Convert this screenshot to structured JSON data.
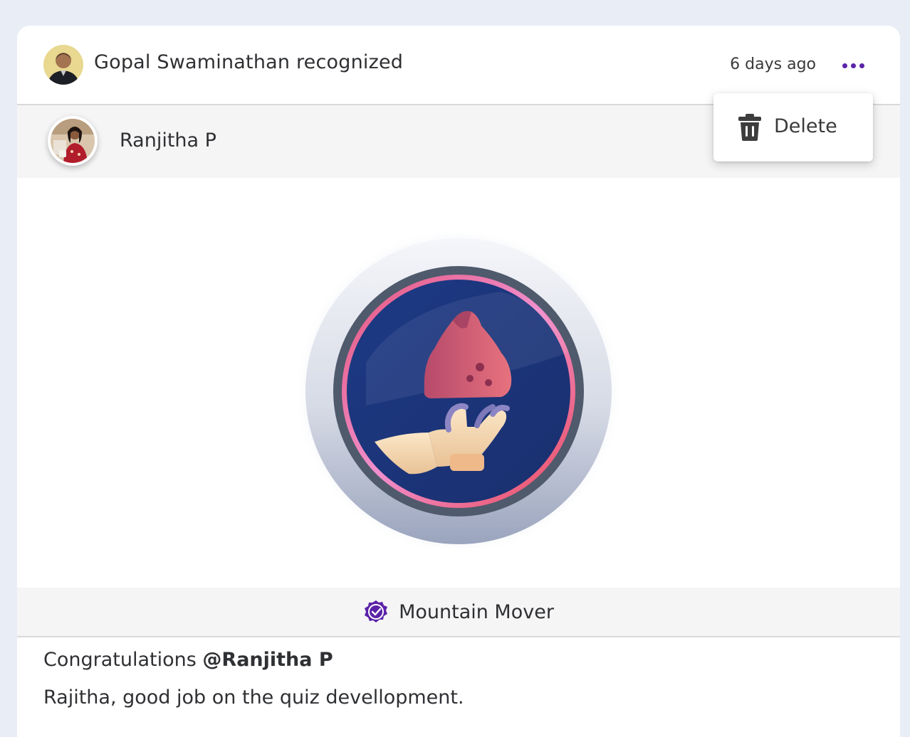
{
  "post": {
    "author_name": "Gopal Swaminathan",
    "action_text": "recognized",
    "title": "Gopal Swaminathan recognized",
    "timestamp": "6 days ago"
  },
  "recipient": {
    "name": "Ranjitha P"
  },
  "badge": {
    "name": "Mountain Mover",
    "icon": "mountain-hand-badge"
  },
  "message": {
    "congrats_prefix": "Congratulations",
    "mention": "@Ranjitha P",
    "body": "Rajitha, good job on the quiz devellopment."
  },
  "menu": {
    "items": [
      {
        "label": "Delete",
        "icon": "trash-icon"
      }
    ]
  },
  "colors": {
    "accent": "#5b23a8",
    "background": "#e9edf5"
  }
}
